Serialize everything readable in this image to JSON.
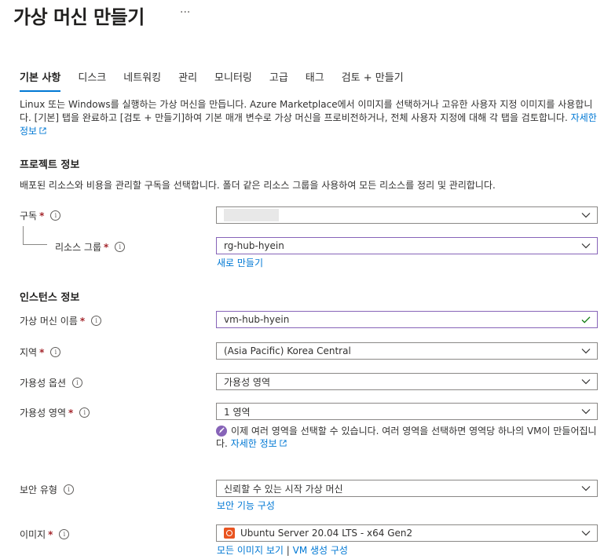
{
  "page": {
    "title": "가상 머신 만들기",
    "more_label": "···"
  },
  "tabs": [
    {
      "label": "기본 사항",
      "active": true
    },
    {
      "label": "디스크"
    },
    {
      "label": "네트워킹"
    },
    {
      "label": "관리"
    },
    {
      "label": "모니터링"
    },
    {
      "label": "고급"
    },
    {
      "label": "태그"
    },
    {
      "label": "검토 + 만들기"
    }
  ],
  "intro": {
    "text": "Linux 또는 Windows를 실행하는 가상 머신을 만듭니다. Azure Marketplace에서 이미지를 선택하거나 고유한 사용자 지정 이미지를 사용합니다. [기본] 탭을 완료하고 [검토 + 만들기]하여 기본 매개 변수로 가상 머신을 프로비전하거나, 전체 사용자 지정에 대해 각 탭을 검토합니다.",
    "link": "자세한 정보"
  },
  "project": {
    "heading": "프로젝트 정보",
    "description": "배포된 리소스와 비용을 관리할 구독을 선택합니다. 폴더 같은 리소스 그룹을 사용하여 모든 리소스를 정리 및 관리합니다.",
    "subscription_label": "구독",
    "subscription_value": "",
    "resource_group_label": "리소스 그룹",
    "resource_group_value": "rg-hub-hyein",
    "create_new_link": "새로 만들기"
  },
  "instance": {
    "heading": "인스턴스 정보",
    "vm_name_label": "가상 머신 이름",
    "vm_name_value": "vm-hub-hyein",
    "region_label": "지역",
    "region_value": "(Asia Pacific) Korea Central",
    "availability_option_label": "가용성 옵션",
    "availability_option_value": "가용성 영역",
    "availability_zone_label": "가용성 영역",
    "availability_zone_value": "1 영역",
    "zone_notice_text": "이제 여러 영역을 선택할 수 있습니다. 여러 영역을 선택하면 영역당 하나의 VM이 만들어집니다.",
    "zone_notice_link": "자세한 정보",
    "security_type_label": "보안 유형",
    "security_type_value": "신뢰할 수 있는 시작 가상 머신",
    "security_config_link": "보안 기능 구성",
    "image_label": "이미지",
    "image_value": "Ubuntu Server 20.04 LTS - x64 Gen2",
    "image_links": [
      "모든 이미지 보기",
      "VM 생성 구성"
    ],
    "image_link_separator": "|"
  },
  "colors": {
    "accent": "#0078d4",
    "required": "#a4262c",
    "valid_check": "#107c10",
    "focus_border": "#8764b8",
    "ubuntu": "#e95420"
  },
  "icons": {
    "more": "ellipsis-icon",
    "info": "info-icon",
    "dropdown": "chevron-down-icon",
    "external": "external-link-icon",
    "valid": "checkmark-icon",
    "notice": "rocket-icon",
    "image": "ubuntu-icon"
  }
}
